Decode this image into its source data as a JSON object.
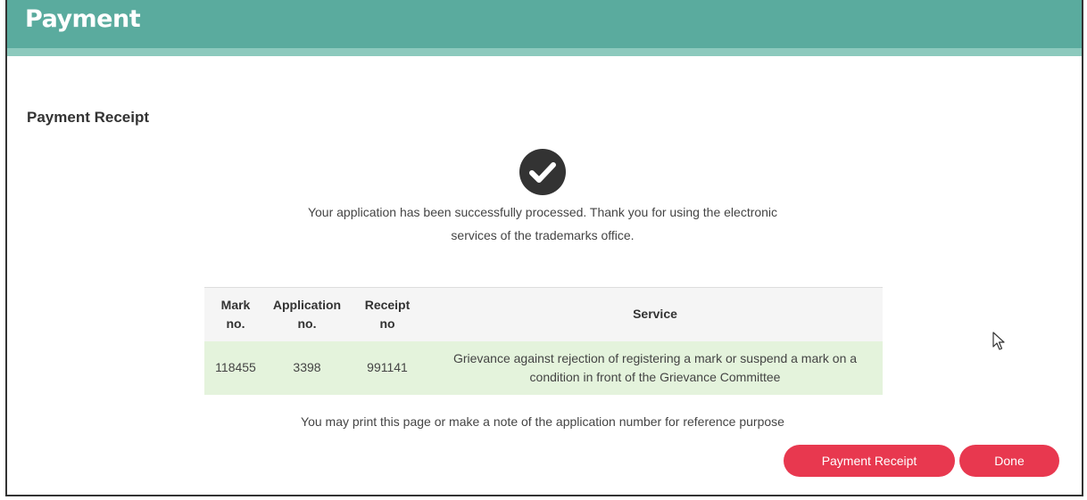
{
  "header": {
    "title": "Payment"
  },
  "section": {
    "title": "Payment Receipt"
  },
  "icons": {
    "success": "check-circle-icon",
    "cursor": "mouse-pointer-icon"
  },
  "message": {
    "line1": "Your application has been successfully processed. Thank you for using the electronic",
    "line2": "services of the trademarks office."
  },
  "table": {
    "headers": {
      "mark": [
        "Mark",
        "no."
      ],
      "application": [
        "Application",
        "no."
      ],
      "receipt": [
        "Receipt",
        "no"
      ],
      "service": "Service"
    },
    "rows": [
      {
        "mark_no": "118455",
        "application_no": "3398",
        "receipt_no": "991141",
        "service_line1": "Grievance against rejection of registering a mark or suspend a mark on a",
        "service_line2": "condition in front of the Grievance Committee"
      }
    ]
  },
  "note": "You may print this page or make a note of the application number for reference purpose",
  "buttons": {
    "payment_receipt": "Payment Receipt",
    "done": "Done"
  },
  "colors": {
    "header": "#5aab9e",
    "header_strip": "#8cc9bd",
    "button": "#e8384f",
    "row_highlight": "#e4f3dc",
    "icon": "#333333"
  }
}
